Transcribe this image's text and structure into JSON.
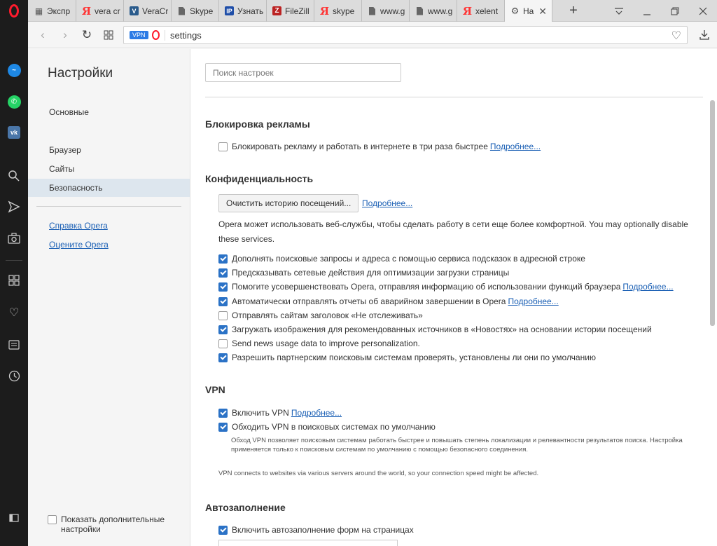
{
  "tabs": [
    {
      "label": "Экспр",
      "icon": "grid-icon"
    },
    {
      "label": "vera cr",
      "icon": "yandex-icon"
    },
    {
      "label": "VeraCr",
      "icon": "veracrypt-icon"
    },
    {
      "label": "Skype",
      "icon": "document-icon"
    },
    {
      "label": "Узнать",
      "icon": "ip-icon"
    },
    {
      "label": "FileZill",
      "icon": "filezilla-icon"
    },
    {
      "label": "skype",
      "icon": "yandex-icon"
    },
    {
      "label": "www.g",
      "icon": "document-icon"
    },
    {
      "label": "www.g",
      "icon": "document-icon"
    },
    {
      "label": "xelent",
      "icon": "yandex-icon"
    },
    {
      "label": "На",
      "icon": "settings-gear-icon",
      "active": true
    }
  ],
  "address": {
    "vpn_badge": "VPN",
    "url": "settings"
  },
  "nav": {
    "title": "Настройки",
    "items": [
      "Основные",
      "Браузер",
      "Сайты",
      "Безопасность"
    ],
    "active": "Безопасность",
    "links": [
      "Справка Opera",
      "Оцените Opera"
    ],
    "show_advanced": "Показать дополнительные настройки"
  },
  "search": {
    "placeholder": "Поиск настроек"
  },
  "adblock": {
    "title": "Блокировка рекламы",
    "option": "Блокировать рекламу и работать в интернете в три раза быстрее",
    "more": "Подробнее..."
  },
  "privacy": {
    "title": "Конфиденциальность",
    "clear_button": "Очистить историю посещений...",
    "more": "Подробнее...",
    "description": "Opera может использовать веб-службы, чтобы сделать работу в сети еще более комфортной. You may optionally disable these services.",
    "options": [
      {
        "label": "Дополнять поисковые запросы и адреса с помощью сервиса подсказок в адресной строке",
        "checked": true,
        "more": ""
      },
      {
        "label": "Предсказывать сетевые действия для оптимизации загрузки страницы",
        "checked": true,
        "more": ""
      },
      {
        "label": "Помогите усовершенствовать Opera, отправляя информацию об использовании функций браузера",
        "checked": true,
        "more": "Подробнее..."
      },
      {
        "label": "Автоматически отправлять отчеты об аварийном завершении в Opera",
        "checked": true,
        "more": "Подробнее..."
      },
      {
        "label": "Отправлять сайтам заголовок «Не отслеживать»",
        "checked": false,
        "more": ""
      },
      {
        "label": "Загружать изображения для рекомендованных источников в «Новостях» на основании истории посещений",
        "checked": true,
        "more": ""
      },
      {
        "label": "Send news usage data to improve personalization.",
        "checked": false,
        "more": ""
      },
      {
        "label": "Разрешить партнерским поисковым системам проверять, установлены ли они по умолчанию",
        "checked": true,
        "more": ""
      }
    ]
  },
  "vpn": {
    "title": "VPN",
    "enable": "Включить VPN",
    "more": "Подробнее...",
    "bypass": "Обходить VPN в поисковых системах по умолчанию",
    "bypass_note": "Обход VPN позволяет поисковым системам работать быстрее и повышать степень локализации и релевантности результатов поиска. Настройка применяется только к поисковым системам по умолчанию с помощью безопасного соединения.",
    "info": "VPN connects to websites via various servers around the world, so your connection speed might be affected."
  },
  "autofill": {
    "title": "Автозаполнение",
    "enable": "Включить автозаполнение форм на страницах"
  }
}
